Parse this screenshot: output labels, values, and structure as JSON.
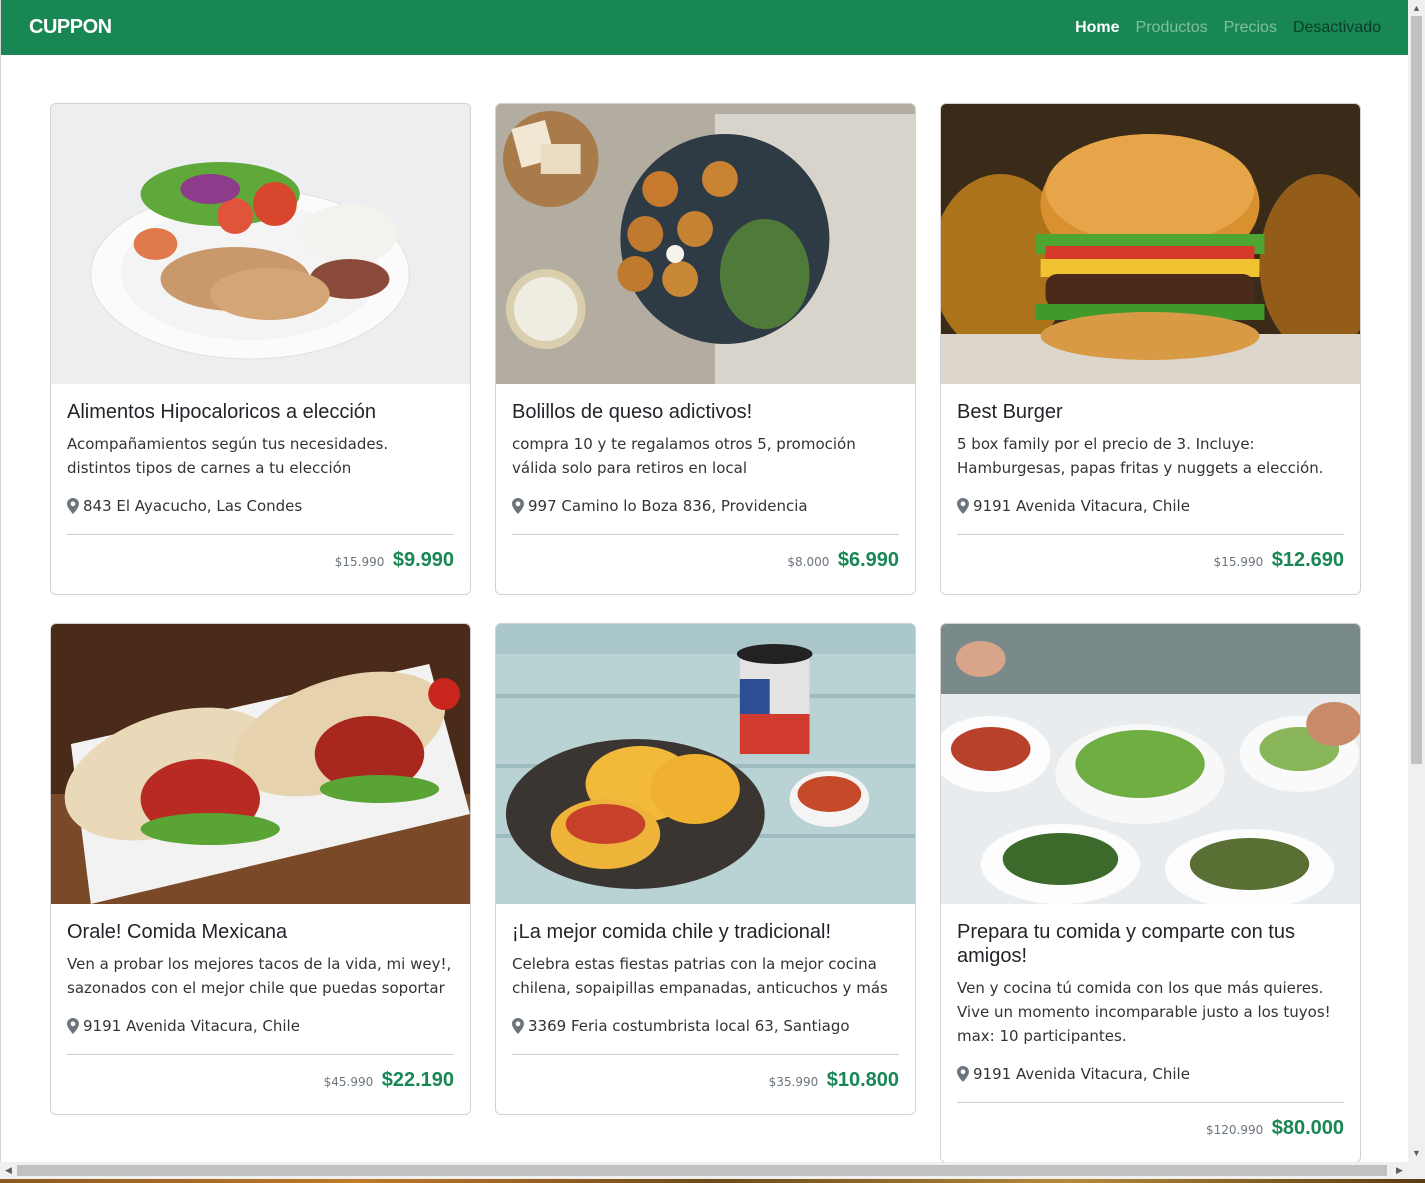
{
  "navbar": {
    "brand": "CUPPON",
    "links": [
      {
        "label": "Home"
      },
      {
        "label": "Productos"
      },
      {
        "label": "Precios"
      },
      {
        "label": "Desactivado"
      }
    ]
  },
  "cards": [
    {
      "title": "Alimentos Hipocaloricos a elección",
      "text": "Acompañamientos según tus necesidades. distintos tipos de carnes a tu elección",
      "location": "843 El Ayacucho, Las Condes",
      "old_price": "$15.990",
      "new_price": "$9.990"
    },
    {
      "title": "Bolillos de queso adictivos!",
      "text": "compra 10 y te regalamos otros 5, promoción válida solo para retiros en local",
      "location": "997 Camino lo Boza 836, Providencia",
      "old_price": "$8.000",
      "new_price": "$6.990"
    },
    {
      "title": "Best Burger",
      "text": "5 box family por el precio de 3. Incluye: Hamburgesas, papas fritas y nuggets a elección.",
      "location": "9191 Avenida Vitacura, Chile",
      "old_price": "$15.990",
      "new_price": "$12.690"
    },
    {
      "title": "Orale! Comida Mexicana",
      "text": "Ven a probar los mejores tacos de la vida, mi wey!, sazonados con el mejor chile que puedas soportar",
      "location": "9191 Avenida Vitacura, Chile",
      "old_price": "$45.990",
      "new_price": "$22.190"
    },
    {
      "title": "¡La mejor comida chile y tradicional!",
      "text": "Celebra estas fiestas patrias con la mejor cocina chilena, sopaipillas empanadas, anticuchos y más",
      "location": "3369 Feria costumbrista local 63, Santiago",
      "old_price": "$35.990",
      "new_price": "$10.800"
    },
    {
      "title": "Prepara tu comida y comparte con tus amigos!",
      "text": "Ven y cocina tú comida con los que más quieres. Vive un momento incomparable justo a los tuyos! max: 10 participantes.",
      "location": "9191 Avenida Vitacura, Chile",
      "old_price": "$120.990",
      "new_price": "$80.000"
    }
  ],
  "colors": {
    "primary": "#198754",
    "price": "#198754"
  }
}
